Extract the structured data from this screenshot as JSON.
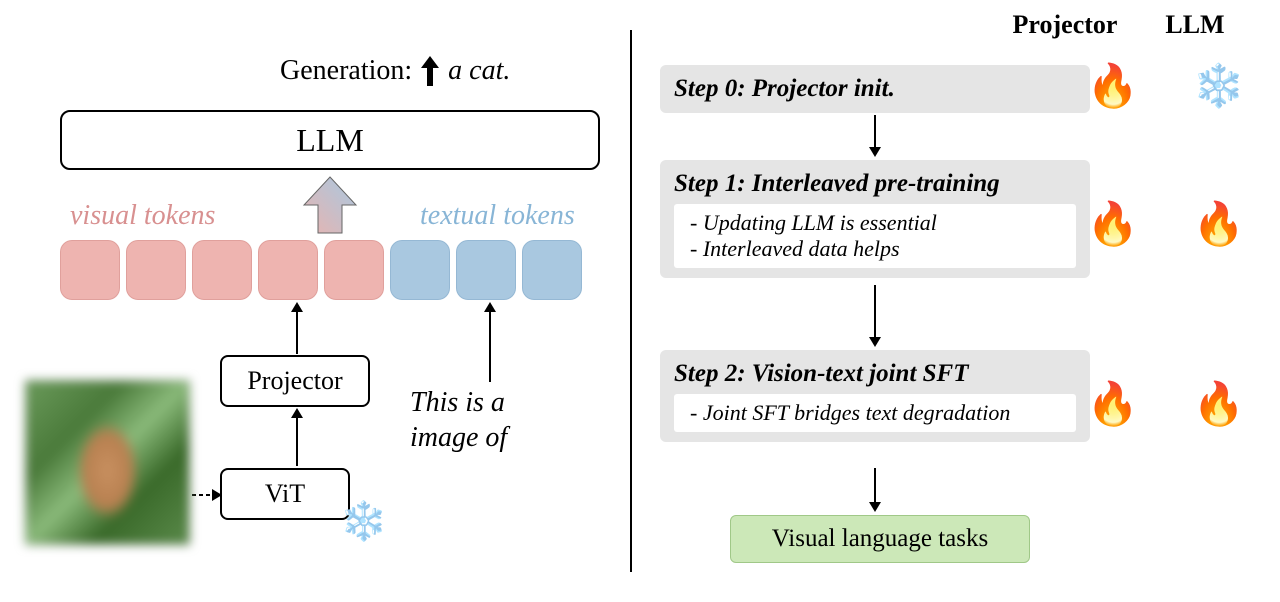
{
  "left": {
    "generation_label": "Generation:",
    "generation_output": "a cat.",
    "llm_label": "LLM",
    "visual_tokens_label": "visual tokens",
    "textual_tokens_label": "textual tokens",
    "projector_label": "Projector",
    "vit_label": "ViT",
    "prompt_line1": "This is a",
    "prompt_line2": "image of",
    "visual_token_count": 5,
    "textual_token_count": 3
  },
  "right": {
    "header_projector": "Projector",
    "header_llm": "LLM",
    "steps": [
      {
        "title": "Step 0: Projector init.",
        "bullets": [],
        "projector": "fire",
        "llm": "ice"
      },
      {
        "title": "Step 1: Interleaved pre-training",
        "bullets": [
          "Updating LLM is essential",
          "Interleaved data helps"
        ],
        "projector": "fire",
        "llm": "fire"
      },
      {
        "title": "Step 2: Vision-text joint SFT",
        "bullets": [
          "Joint SFT bridges text degradation"
        ],
        "projector": "fire",
        "llm": "fire"
      }
    ],
    "final": "Visual language tasks"
  },
  "icons": {
    "fire": "🔥",
    "ice": "❄️"
  }
}
